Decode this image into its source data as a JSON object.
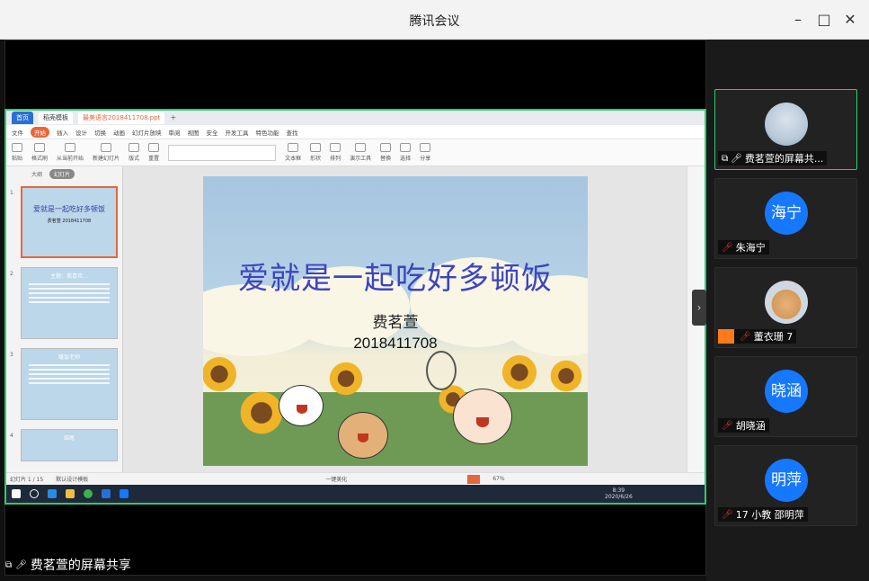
{
  "window": {
    "title": "腾讯会议"
  },
  "share": {
    "label": "费茗萱的屏幕共享"
  },
  "wps": {
    "tabs": [
      "首页",
      "稻壳模板",
      "最美语言2018411708.ppt"
    ],
    "menu": [
      "文件",
      "开始",
      "插入",
      "设计",
      "切换",
      "动画",
      "幻灯片放映",
      "审阅",
      "视图",
      "安全",
      "开发工具",
      "特色功能",
      "查找"
    ],
    "active_menu": "开始",
    "ribbon": [
      "粘贴",
      "格式刷",
      "从当前开始",
      "新建幻灯片",
      "版式",
      "重置",
      "文本框",
      "形状",
      "排列",
      "演示工具",
      "替换",
      "选择",
      "分享"
    ],
    "thumb_tabs": [
      "大纲",
      "幻灯片"
    ],
    "status": {
      "slide_info": "幻灯片 1 / 15",
      "template": "默认设计模板",
      "beautify": "一键美化",
      "zoom": "67%"
    }
  },
  "slide": {
    "title": "爱就是一起吃好多顿饭",
    "name": "费茗萱",
    "student_id": "2018411708"
  },
  "thumbs": [
    {
      "num": "1",
      "title": "爱就是一起吃好多顿饭",
      "sub": "费茗萱 2018411708"
    },
    {
      "num": "2",
      "title": "主题：我喜欢...",
      "sub": ""
    },
    {
      "num": "3",
      "title": "暖饭老师",
      "sub": ""
    },
    {
      "num": "4",
      "title": "结尾",
      "sub": ""
    }
  ],
  "taskbar": {
    "time": "8:39",
    "date": "2020/6/26"
  },
  "participants": [
    {
      "name": "费茗萱的屏幕共...",
      "avatar_text": "",
      "mic": "on",
      "sharing": true
    },
    {
      "name": "朱海宁",
      "avatar_text": "海宁",
      "mic": "off",
      "sharing": false
    },
    {
      "name": "董衣珊 7",
      "avatar_text": "",
      "mic": "off",
      "sharing": false,
      "host": true
    },
    {
      "name": "胡晓涵",
      "avatar_text": "晓涵",
      "mic": "off",
      "sharing": false
    },
    {
      "name": "17 小教 邵明萍",
      "avatar_text": "明萍",
      "mic": "off",
      "sharing": false
    }
  ],
  "colors": {
    "share_border": "#2ecc71",
    "avatar_blue": "#1677ff",
    "wps_accent": "#e8663b",
    "slide_title": "#3d44c2"
  }
}
